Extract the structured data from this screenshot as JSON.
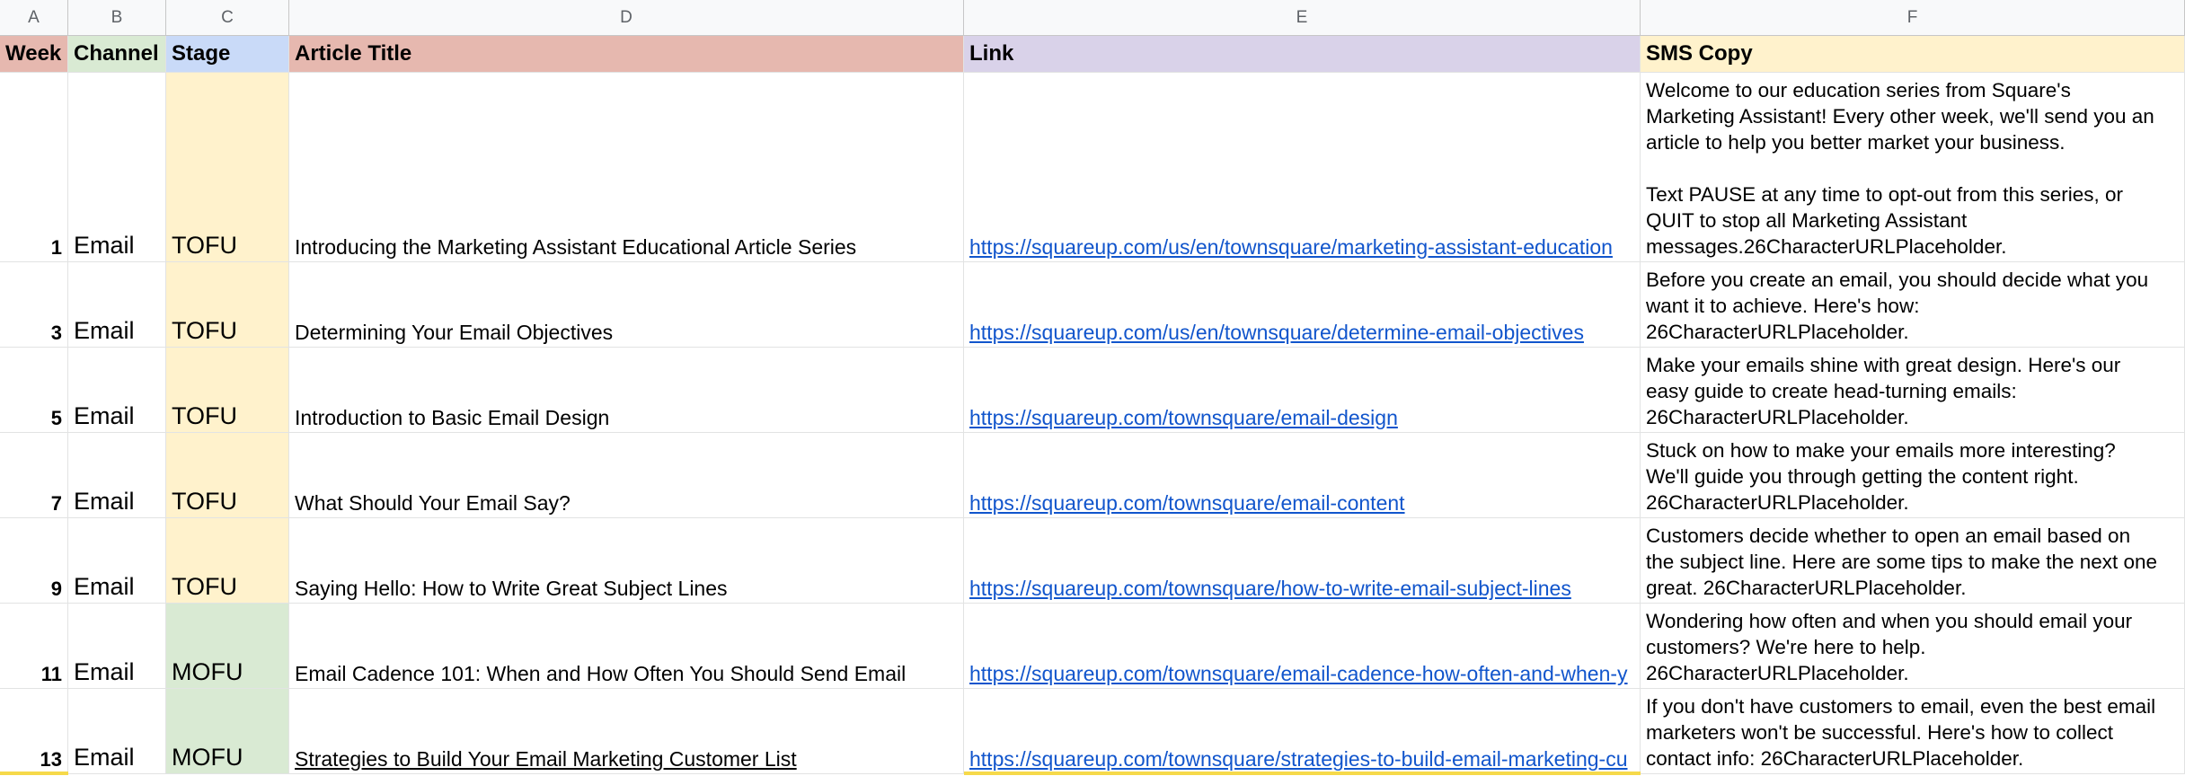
{
  "columns": [
    "A",
    "B",
    "C",
    "D",
    "E",
    "F"
  ],
  "headers": {
    "week": "Week",
    "channel": "Channel",
    "stage": "Stage",
    "title": "Article Title",
    "link": "Link",
    "sms": "SMS Copy"
  },
  "colors": {
    "week_header": "#e6b8af",
    "channel_header": "#d9ead3",
    "stage_header": "#c9daf8",
    "title_header": "#e6b8af",
    "link_header": "#d9d2e9",
    "sms_header": "#fff2cc",
    "tofu": "#fff2cc",
    "mofu": "#d9ead3",
    "link_text": "#1155cc"
  },
  "rows": [
    {
      "week": "1",
      "channel": "Email",
      "stage": "TOFU",
      "title": "Introducing the Marketing Assistant Educational Article Series",
      "link": "https://squareup.com/us/en/townsquare/marketing-assistant-education",
      "sms_lines": [
        "Welcome to our education series from Square's",
        "Marketing Assistant! Every other week, we'll send you an",
        "article to help you better market your business.",
        "",
        "Text PAUSE at any time to opt-out from this series, or",
        "QUIT to stop all Marketing Assistant",
        "messages.26CharacterURLPlaceholder."
      ]
    },
    {
      "week": "3",
      "channel": "Email",
      "stage": "TOFU",
      "title": "Determining Your Email Objectives",
      "link": "https://squareup.com/us/en/townsquare/determine-email-objectives",
      "sms_lines": [
        "Before you create an email, you should decide what you",
        "want it to achieve. Here's how:",
        "26CharacterURLPlaceholder."
      ]
    },
    {
      "week": "5",
      "channel": "Email",
      "stage": "TOFU",
      "title": "Introduction to Basic Email Design",
      "link": "https://squareup.com/townsquare/email-design",
      "sms_lines": [
        "Make your emails shine with great design. Here's our",
        "easy guide to create head-turning emails:",
        "26CharacterURLPlaceholder."
      ]
    },
    {
      "week": "7",
      "channel": "Email",
      "stage": "TOFU",
      "title": "What Should Your Email Say?",
      "link": "https://squareup.com/townsquare/email-content",
      "sms_lines": [
        "Stuck on how to make your emails more interesting?",
        "We'll guide you through getting the content right.",
        "26CharacterURLPlaceholder."
      ]
    },
    {
      "week": "9",
      "channel": "Email",
      "stage": "TOFU",
      "title": "Saying Hello: How to Write Great Subject Lines",
      "link": "https://squareup.com/townsquare/how-to-write-email-subject-lines",
      "sms_lines": [
        "Customers decide whether to open an email based on",
        "the subject line. Here are some tips to make the next one",
        "great. 26CharacterURLPlaceholder."
      ]
    },
    {
      "week": "11",
      "channel": "Email",
      "stage": "MOFU",
      "title": "Email Cadence 101: When and How Often You Should Send Email",
      "link": "https://squareup.com/townsquare/email-cadence-how-often-and-when-y",
      "sms_lines": [
        "Wondering how often and when you should email your",
        "customers? We're here to help.",
        "26CharacterURLPlaceholder."
      ]
    },
    {
      "week": "13",
      "channel": "Email",
      "stage": "MOFU",
      "title": "Strategies to Build Your Email Marketing Customer List",
      "link": "https://squareup.com/townsquare/strategies-to-build-email-marketing-cu",
      "sms_lines": [
        "If you don't have customers to email, even the best email",
        "marketers won't be successful. Here's how to collect",
        "contact info: 26CharacterURLPlaceholder."
      ]
    }
  ]
}
